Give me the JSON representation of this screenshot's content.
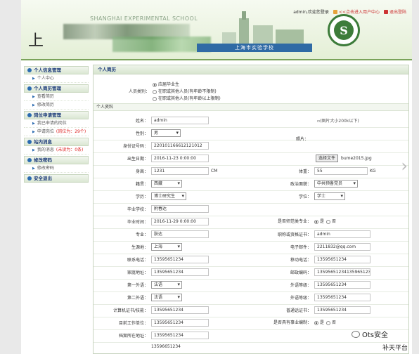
{
  "header": {
    "school_en": "SHANGHAI EXPERIMENTAL SCHOOL",
    "school_cn": "上海市实验学校",
    "calligraphy_visible": "上 ",
    "user_text": "admin,欢迎您登录",
    "link1": "<<点击进入用户中心",
    "link2": "退出登陆",
    "accent": "#3d7c3a"
  },
  "sidebar": {
    "groups": [
      {
        "title": "个人信息管理",
        "items": [
          {
            "label": "个人中心"
          }
        ]
      },
      {
        "title": "个人简历管理",
        "items": [
          {
            "label": "查看简历"
          },
          {
            "label": "修改简历"
          }
        ]
      },
      {
        "title": "岗位申请管理",
        "items": [
          {
            "label": "我已申请的岗位"
          },
          {
            "label": "申请岗位",
            "extra": "(岗位为：29个)"
          }
        ]
      },
      {
        "title": "站内消息",
        "items": [
          {
            "label": "我的消息",
            "extra": "(未读为：0条)"
          }
        ]
      },
      {
        "title": "修改密码",
        "items": [
          {
            "label": "修改密码"
          }
        ]
      },
      {
        "title": "安全退出",
        "items": []
      }
    ]
  },
  "main": {
    "title": "个人简历",
    "person_category_label": "人员类别：",
    "category_options": [
      "应届毕业生",
      "在职或其他人员(有年龄不限制)",
      "在职或其他人员(有年龄以上限制)"
    ],
    "section_label": "个人资料",
    "name_label": "姓名：",
    "name_value": "admin",
    "gender_label": "性别：",
    "gender_value": "男",
    "id_label": "身份证号码：",
    "id_value": "220101166612121012",
    "birth_label": "出生日期：",
    "birth_value": "2016-11-23 0:00:00",
    "photo_label": "照片：",
    "photo_alt": "(图片大小200k以下)",
    "file_button": "选择文件",
    "file_name": "bume2015.jpg",
    "height_label": "身高：",
    "height_value": "1231",
    "height_unit": "CM",
    "weight_label": "体重：",
    "weight_value": "55",
    "weight_unit": "KG",
    "nation_label": "籍贯：",
    "nation_value": "西藏",
    "politics_label": "政治面貌：",
    "politics_value": "中共预备党员",
    "education_label": "学历：",
    "education_value": "博士研究生",
    "degree_label": "学位：",
    "degree_value": "学士",
    "school_label": "毕业学校：",
    "school_value": "附春达",
    "grad_time_label": "毕业时间：",
    "grad_time_value": "2016-11-29 0:00:00",
    "normal_label": "是否师范类专业：",
    "normal_options": [
      "是",
      "否"
    ],
    "major_label": "专业：",
    "major_value": "肤达",
    "teacher_cert_label": "职称或资格证书：",
    "teacher_cert_value": "admin",
    "birthplace_label": "生源地：",
    "birthplace_value": "上海",
    "email_label": "电子邮件：",
    "email_value": "2211832@qq.com",
    "phone_label": "联系电话：",
    "phone_value": "13595651234",
    "mobile_label": "移动电话：",
    "mobile_value": "13595651234",
    "address_label": "家庭地址：",
    "address_value": "13595651234",
    "postcode_label": "邮政编码：",
    "postcode_value": "13595651234135965123",
    "lang1_label": "第一外语：",
    "lang1_value": "法语",
    "lang1_level_label": "外语等级：",
    "lang1_level_value": "13595651234",
    "lang2_label": "第二外语：",
    "lang2_value": "法语",
    "lang2_level_label": "外语等级：",
    "lang2_level_value": "13595651234",
    "computer_label": "计算机证书/技能：",
    "computer_value": "13595651234",
    "mandarin_label": "普通话证书：",
    "mandarin_value": "13595651234",
    "work_label": "目前工作单位：",
    "work_value": "13595651234",
    "career_label": "是否具有事业编制：",
    "career_options": [
      "是",
      "否"
    ],
    "archive_label": "档案所在地址：",
    "archive_value": "13595651234",
    "bottom_value": "13596651234"
  },
  "watermark": {
    "text": "Ots安全",
    "text2": "补天平台"
  }
}
